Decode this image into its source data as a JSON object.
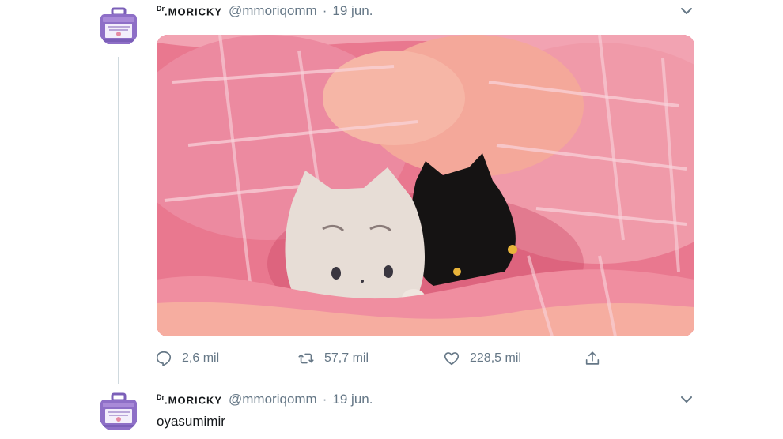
{
  "tweets": [
    {
      "author": {
        "name_prefix": "Dr",
        "name": ".MORICKY",
        "handle": "@mmoriqomm"
      },
      "separator": "·",
      "date": "19 jun.",
      "stats": {
        "replies": "2,6 mil",
        "retweets": "57,7 mil",
        "likes": "228,5 mil"
      }
    },
    {
      "author": {
        "name_prefix": "Dr",
        "name": ".MORICKY",
        "handle": "@mmoriqomm"
      },
      "separator": "·",
      "date": "19 jun.",
      "text": "oyasumimir"
    }
  ],
  "icons": {
    "menu": "chevron-down-icon",
    "reply": "reply-icon",
    "retweet": "retweet-icon",
    "like": "heart-icon",
    "share": "share-icon"
  },
  "colors": {
    "secondary_text": "#657786",
    "thread_line": "#cfd9de",
    "avatar_purple": "#8e6fc7"
  }
}
